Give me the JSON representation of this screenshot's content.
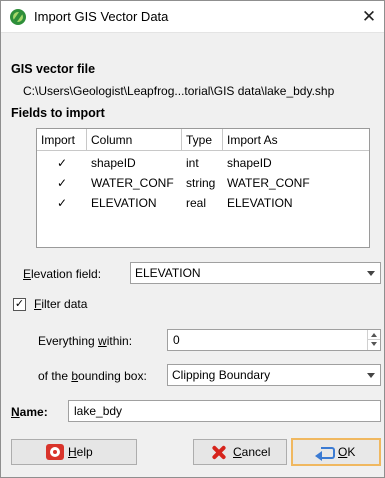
{
  "window": {
    "title": "Import GIS Vector Data",
    "close_glyph": "✕"
  },
  "gis_file": {
    "section_label": "GIS vector file",
    "path": "C:\\Users\\Geologist\\Leapfrog...torial\\GIS data\\lake_bdy.shp"
  },
  "fields": {
    "section_label": "Fields to import",
    "headers": {
      "import": "Import",
      "column": "Column",
      "type": "Type",
      "import_as": "Import As"
    },
    "rows": [
      {
        "checked": true,
        "check_glyph": "✓",
        "column": "shapeID",
        "type": "int",
        "import_as": "shapeID"
      },
      {
        "checked": true,
        "check_glyph": "✓",
        "column": "WATER_CONF",
        "type": "string",
        "import_as": "WATER_CONF"
      },
      {
        "checked": true,
        "check_glyph": "✓",
        "column": "ELEVATION",
        "type": "real",
        "import_as": "ELEVATION"
      }
    ]
  },
  "elevation": {
    "label_prefix": "",
    "label_mnemonic": "E",
    "label_rest": "levation field:",
    "value": "ELEVATION"
  },
  "filter": {
    "checked": true,
    "check_glyph": "✓",
    "label_mnemonic": "F",
    "label_rest": "ilter data"
  },
  "within": {
    "label_pre": "Everything ",
    "label_mnemonic": "w",
    "label_rest": "ithin:",
    "value": "0"
  },
  "bbox": {
    "label_pre": "of the ",
    "label_mnemonic": "b",
    "label_rest": "ounding box:",
    "value": "Clipping Boundary"
  },
  "name": {
    "label_mnemonic": "N",
    "label_rest": "ame:",
    "value": "lake_bdy"
  },
  "buttons": {
    "help": {
      "mnemonic": "H",
      "rest": "elp"
    },
    "cancel": {
      "mnemonic": "C",
      "rest": "ancel"
    },
    "ok": {
      "mnemonic": "O",
      "rest": "K"
    }
  }
}
